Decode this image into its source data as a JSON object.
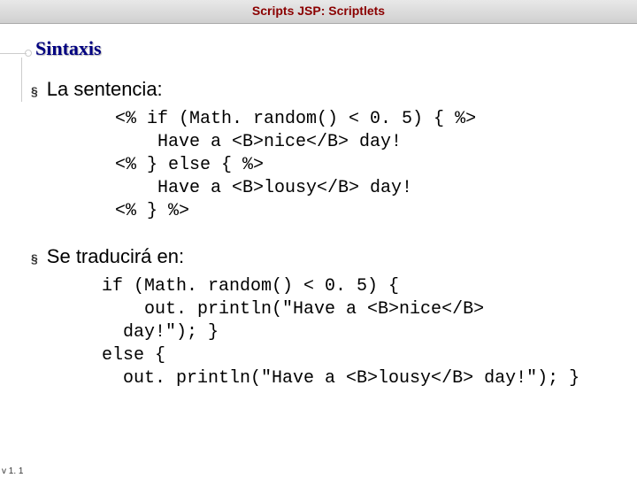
{
  "header": {
    "title": "Scripts JSP: Scriptlets"
  },
  "heading": "Sintaxis",
  "bullets": {
    "item1": "La sentencia:",
    "item2": "Se traducirá en:"
  },
  "code1": "<% if (Math. random() < 0. 5) { %>\n    Have a <B>nice</B> day!\n<% } else { %>\n    Have a <B>lousy</B> day!\n<% } %>",
  "code2": "if (Math. random() < 0. 5) {\n    out. println(\"Have a <B>nice</B>\n  day!\"); }\nelse {\n  out. println(\"Have a <B>lousy</B> day!\"); }",
  "version": "v 1. 1"
}
